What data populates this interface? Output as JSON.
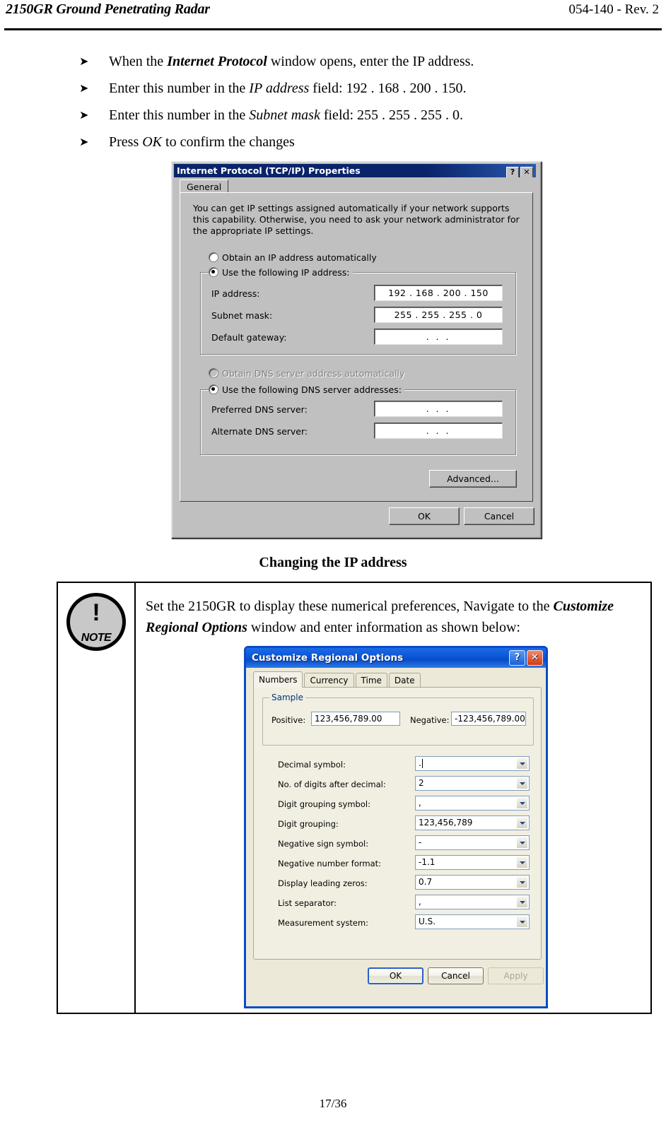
{
  "header": {
    "left_title": "2150GR Ground Penetrating Radar",
    "right_title": "054-140 - Rev. 2"
  },
  "instructions": {
    "bullet_glyph": "➤",
    "items": [
      {
        "pre": "When the ",
        "em": "Internet Protocol",
        "em_style": "bold-italic",
        "post": " window opens, enter the IP address."
      },
      {
        "pre": "Enter this number in the ",
        "em": "IP address",
        "em_style": "italic",
        "post": " field: 192 . 168 . 200 . 150."
      },
      {
        "pre": "Enter this number in the ",
        "em": "Subnet mask",
        "em_style": "italic",
        "post": " field: 255 . 255 . 255 . 0."
      },
      {
        "pre": "Press ",
        "em": "OK",
        "em_style": "italic",
        "post": " to confirm the changes"
      }
    ]
  },
  "tcpip_dialog": {
    "title": "Internet Protocol (TCP/IP) Properties",
    "titlebar_buttons": [
      {
        "name": "help-button",
        "glyph": "?"
      },
      {
        "name": "close-button",
        "glyph": "✕"
      }
    ],
    "tab": "General",
    "description": "You can get IP settings assigned automatically if your network supports this capability. Otherwise, you need to ask your network administrator for the appropriate IP settings.",
    "radio_auto_ip": "Obtain an IP address automatically",
    "radio_manual_ip": "Use the following IP address:",
    "fields": [
      {
        "label": "IP address:",
        "value": "192 . 168 . 200 . 150"
      },
      {
        "label": "Subnet mask:",
        "value": "255 . 255 . 255 .   0"
      },
      {
        "label": "Default gateway:",
        "value": " .     .     . "
      }
    ],
    "radio_auto_dns": "Obtain DNS server address automatically",
    "radio_manual_dns": "Use the following DNS server addresses:",
    "dns_fields": [
      {
        "label": "Preferred DNS server:",
        "value": " .     .     . "
      },
      {
        "label": "Alternate DNS server:",
        "value": " .     .     . "
      }
    ],
    "advanced_button": "Advanced...",
    "ok_button": "OK",
    "cancel_button": "Cancel"
  },
  "figure_caption": "Changing the IP address",
  "note": {
    "icon_bang": "!",
    "icon_word": "NOTE",
    "line1": "Set the 2150GR to display these numerical preferences, Navigate to the ",
    "emphasis": "Customize Regional Options",
    "line2": " window and enter information as shown below:"
  },
  "regional_dialog": {
    "title": "Customize Regional Options",
    "titlebar_buttons": [
      {
        "name": "help-button",
        "glyph": "?"
      },
      {
        "name": "close-button",
        "glyph": "✕"
      }
    ],
    "tabs": [
      "Numbers",
      "Currency",
      "Time",
      "Date"
    ],
    "active_tab": "Numbers",
    "sample": {
      "group_label": "Sample",
      "positive_label": "Positive:",
      "positive_value": "123,456,789.00",
      "negative_label": "Negative:",
      "negative_value": "-123,456,789.00"
    },
    "settings": [
      {
        "label": "Decimal symbol:",
        "value": ".",
        "caret": true
      },
      {
        "label": "No. of digits after decimal:",
        "value": "2",
        "caret": false
      },
      {
        "label": "Digit grouping symbol:",
        "value": ",",
        "caret": false
      },
      {
        "label": "Digit grouping:",
        "value": "123,456,789",
        "caret": false
      },
      {
        "label": "Negative sign symbol:",
        "value": "-",
        "caret": false
      },
      {
        "label": "Negative number format:",
        "value": "-1.1",
        "caret": false
      },
      {
        "label": "Display leading zeros:",
        "value": "0.7",
        "caret": false
      },
      {
        "label": "List separator:",
        "value": ",",
        "caret": false
      },
      {
        "label": "Measurement system:",
        "value": "U.S.",
        "caret": false
      }
    ],
    "ok_button": "OK",
    "cancel_button": "Cancel",
    "apply_button": "Apply"
  },
  "footer": {
    "page_number": "17/36"
  },
  "colors": {
    "win2k_face": "#c0c0c0",
    "win2k_titlebar": "#0a246a",
    "winxp_face": "#ece9d8",
    "winxp_titlebar": "#0a4bc8",
    "winxp_group_label": "#00357f"
  }
}
